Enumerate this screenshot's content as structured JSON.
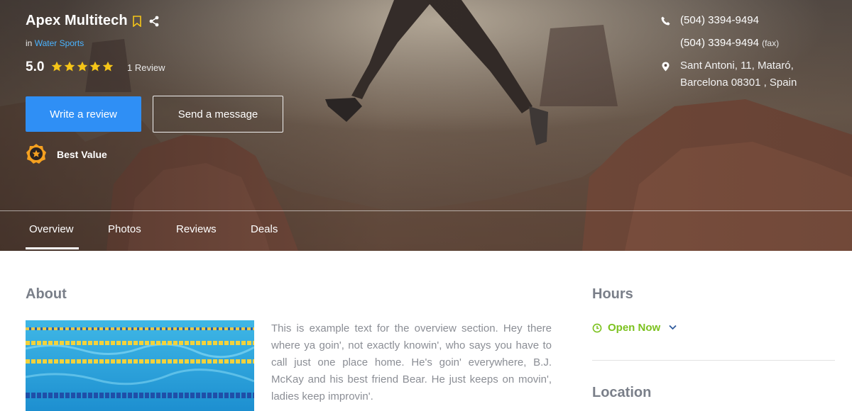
{
  "business": {
    "name": "Apex Multitech",
    "category_prefix": "in",
    "category": "Water Sports",
    "rating": "5.0",
    "rating_stars": 5,
    "review_count": "1 Review"
  },
  "actions": {
    "write_review": "Write a review",
    "send_message": "Send a message"
  },
  "badge": {
    "label": "Best Value"
  },
  "contact": {
    "phone": "(504) 3394-9494",
    "fax": "(504) 3394-9494",
    "fax_suffix": "(fax)",
    "address_line1": "Sant Antoni, 11, Mataró,",
    "address_line2": "Barcelona 08301 , Spain"
  },
  "tabs": [
    {
      "label": "Overview",
      "active": true
    },
    {
      "label": "Photos",
      "active": false
    },
    {
      "label": "Reviews",
      "active": false
    },
    {
      "label": "Deals",
      "active": false
    }
  ],
  "about": {
    "heading": "About",
    "text": "This is example text for the overview section. Hey there where ya goin', not exactly knowin', who says you have to call just one place home. He's goin' everywhere, B.J. McKay and his best friend Bear. He just keeps on movin', ladies keep improvin'."
  },
  "hours": {
    "heading": "Hours",
    "status": "Open Now"
  },
  "location": {
    "heading": "Location"
  },
  "colors": {
    "accent_blue": "#2f8ff5",
    "link_blue": "#4ab3ff",
    "star_yellow": "#f5c518",
    "open_green": "#7cc21f",
    "heading_gray": "#7a7f89"
  },
  "icons": {
    "bookmark": "bookmark-icon",
    "share": "share-icon",
    "star": "star-icon",
    "badge": "medal-star-icon",
    "phone": "phone-icon",
    "location": "map-pin-icon",
    "clock": "clock-icon",
    "chevron": "chevron-down-icon"
  }
}
